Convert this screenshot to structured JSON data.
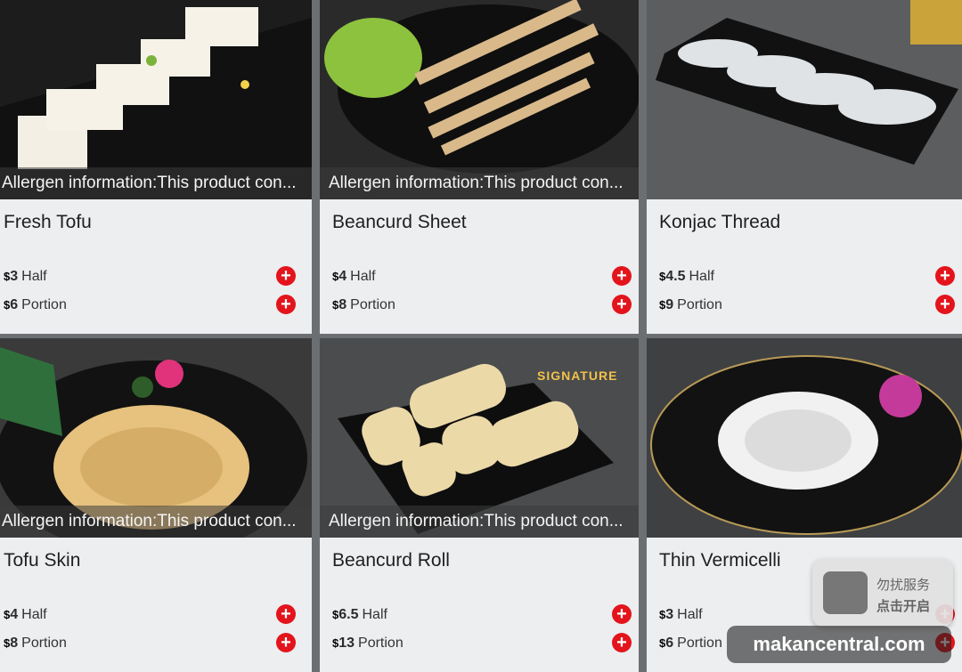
{
  "colors": {
    "add_button": "#e3141b",
    "card_bg": "#eceef0"
  },
  "items": [
    {
      "name": "Fresh Tofu",
      "allergen": "Allergen information:This product con...",
      "prices": [
        {
          "amount": "3",
          "label": "Half"
        },
        {
          "amount": "6",
          "label": "Portion"
        }
      ]
    },
    {
      "name": "Beancurd Sheet",
      "allergen": "Allergen information:This product con...",
      "prices": [
        {
          "amount": "4",
          "label": "Half"
        },
        {
          "amount": "8",
          "label": "Portion"
        }
      ]
    },
    {
      "name": "Konjac Thread",
      "allergen": "Allergen information:This product con...",
      "prices": [
        {
          "amount": "4.5",
          "label": "Half"
        },
        {
          "amount": "9",
          "label": "Portion"
        }
      ]
    },
    {
      "name": "Tofu Skin",
      "allergen": "Allergen information:This product con...",
      "prices": [
        {
          "amount": "4",
          "label": "Half"
        },
        {
          "amount": "8",
          "label": "Portion"
        }
      ]
    },
    {
      "name": "Beancurd Roll",
      "allergen": "Allergen information:This product con...",
      "signature": "SIGNATURE",
      "prices": [
        {
          "amount": "6.5",
          "label": "Half"
        },
        {
          "amount": "13",
          "label": "Portion"
        }
      ]
    },
    {
      "name": "Thin Vermicelli",
      "allergen": "",
      "prices": [
        {
          "amount": "3",
          "label": "Half"
        },
        {
          "amount": "6",
          "label": "Portion"
        }
      ]
    }
  ],
  "currency": "$",
  "add_icon": "plus-icon",
  "overlay_widget": {
    "line1": "勿扰服务",
    "line2": "点击开启"
  },
  "watermark": "makancentral.com"
}
